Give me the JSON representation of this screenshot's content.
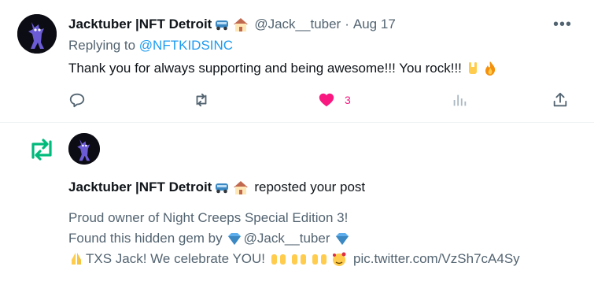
{
  "reply": {
    "author_name": "Jacktuber |NFT Detroit",
    "author_emojis": [
      "car-icon",
      "house-icon"
    ],
    "handle": "@Jack__tuber",
    "separator": "·",
    "date": "Aug 17",
    "replying_prefix": "Replying to",
    "replying_to": "@NFTKIDSINC",
    "text": "Thank you for always supporting and being awesome!!! You rock!!!",
    "text_emojis": [
      "rock-hand-icon",
      "fire-icon"
    ],
    "more": "•••",
    "actions": {
      "reply_icon": "reply-icon",
      "repost_icon": "repost-icon",
      "like_icon": "heart-filled-icon",
      "like_count": "3",
      "views_icon": "views-icon",
      "share_icon": "share-icon"
    },
    "colors": {
      "like": "#f91880",
      "mention": "#1d9bf0",
      "muted": "#536471"
    }
  },
  "notification": {
    "icon": "repost-icon",
    "icon_color": "#00ba7c",
    "author_name": "Jacktuber |NFT Detroit",
    "author_emojis": [
      "car-icon",
      "house-icon"
    ],
    "action_text": "reposted your post",
    "quote": {
      "line1": "Proud owner of Night Creeps Special Edition 3!",
      "line2_prefix": "Found this hidden gem by",
      "line2_handle": "@Jack__tuber",
      "line2_emojis": [
        "gem-icon",
        "gem-icon"
      ],
      "line3_text": "TXS Jack! We celebrate YOU!",
      "line3_emojis": [
        "folded-hands-icon",
        "raising-hands-icon",
        "smiling-hearts-icon"
      ],
      "link": "pic.twitter.com/VzSh7cA4Sy"
    }
  }
}
